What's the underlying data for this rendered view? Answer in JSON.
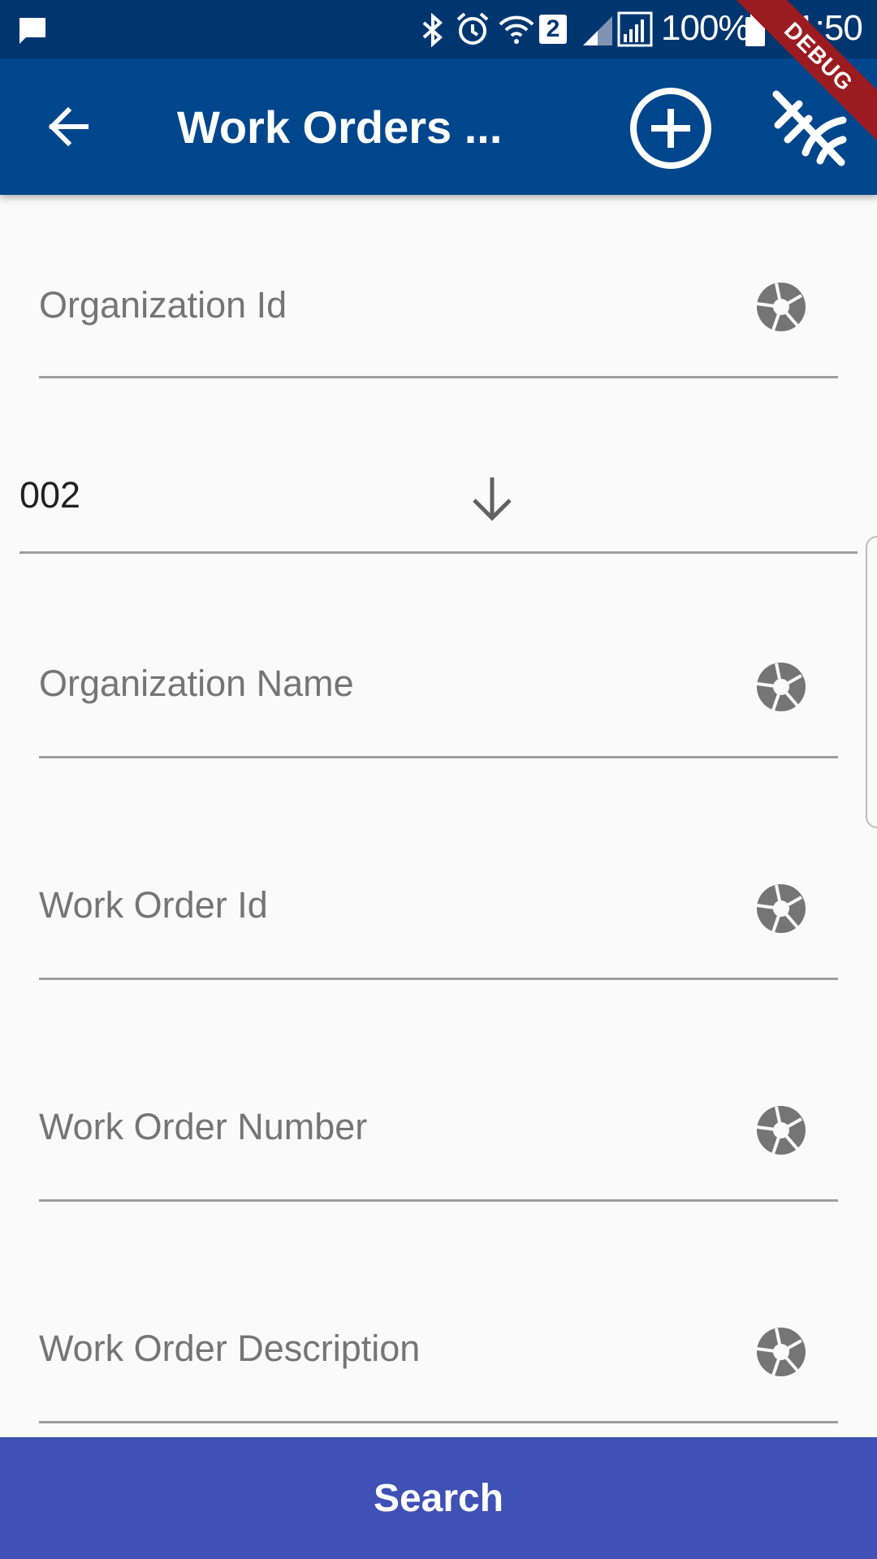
{
  "status_bar": {
    "battery": "100%",
    "time": "11:50",
    "sim_badge": "2",
    "icons": [
      "message-icon",
      "bluetooth-icon",
      "alarm-icon",
      "wifi-icon",
      "sim-icon",
      "signal-icon",
      "battery-icon"
    ]
  },
  "app_bar": {
    "title": "Work Orders ...",
    "back_icon": "arrow-back-icon",
    "add_icon": "add-circle-icon",
    "clear_icon": "cancel-filter-icon",
    "color": "#00468d"
  },
  "debug_banner": "DEBUG",
  "form": {
    "organization_id_label": "Organization Id",
    "organization_dropdown_value": "002",
    "organization_name_label": "Organization Name",
    "work_order_id_label": "Work Order Id",
    "work_order_number_label": "Work Order Number",
    "work_order_description_label": "Work Order Description",
    "field_icon": "camera-shutter-icon"
  },
  "search_button": {
    "label": "Search",
    "color": "#3f51b5"
  }
}
